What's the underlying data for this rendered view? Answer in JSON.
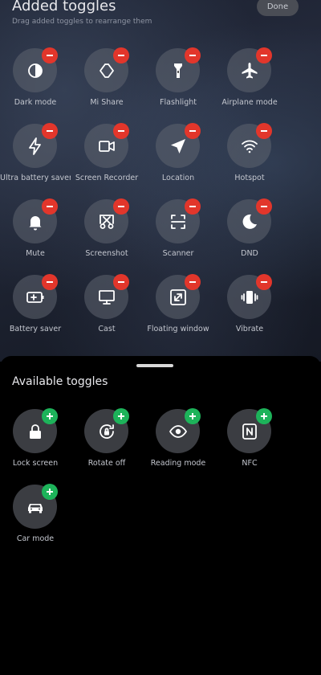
{
  "header": {
    "title": "Added toggles",
    "subtitle": "Drag added toggles to rearrange them",
    "done_label": "Done"
  },
  "added_toggles": [
    {
      "label": "Dark mode",
      "icon": "dark-mode-icon"
    },
    {
      "label": "Mi Share",
      "icon": "mi-share-icon"
    },
    {
      "label": "Flashlight",
      "icon": "flashlight-icon"
    },
    {
      "label": "Airplane mode",
      "icon": "airplane-icon"
    },
    {
      "label": "Ultra battery saver",
      "icon": "lightning-icon"
    },
    {
      "label": "Screen Recorder",
      "icon": "video-camera-icon"
    },
    {
      "label": "Location",
      "icon": "location-arrow-icon"
    },
    {
      "label": "Hotspot",
      "icon": "hotspot-icon"
    },
    {
      "label": "Mute",
      "icon": "bell-icon"
    },
    {
      "label": "Screenshot",
      "icon": "scissors-icon"
    },
    {
      "label": "Scanner",
      "icon": "scanner-icon"
    },
    {
      "label": "DND",
      "icon": "moon-icon"
    },
    {
      "label": "Battery saver",
      "icon": "battery-icon"
    },
    {
      "label": "Cast",
      "icon": "monitor-icon"
    },
    {
      "label": "Floating window",
      "icon": "floating-window-icon"
    },
    {
      "label": "Vibrate",
      "icon": "vibrate-icon"
    }
  ],
  "available": {
    "title": "Available toggles",
    "toggles": [
      {
        "label": "Lock screen",
        "icon": "lock-icon"
      },
      {
        "label": "Rotate off",
        "icon": "rotate-lock-icon"
      },
      {
        "label": "Reading mode",
        "icon": "eye-icon"
      },
      {
        "label": "NFC",
        "icon": "nfc-icon"
      },
      {
        "label": "Car mode",
        "icon": "car-icon"
      }
    ]
  },
  "colors": {
    "remove_badge": "#e2362b",
    "add_badge": "#1db35a"
  }
}
